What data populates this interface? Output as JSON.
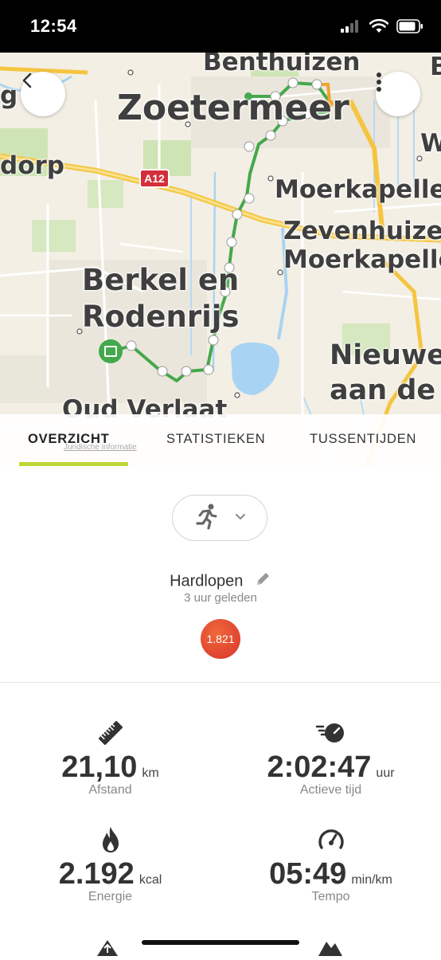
{
  "status_bar": {
    "time": "12:54"
  },
  "map": {
    "labels": {
      "benthuizen": "Benthuizen",
      "zoetermeer": "Zoetermeer",
      "dorp": "dorp",
      "a12": "A12",
      "moerkapelle1": "Moerkapelle",
      "zevenhuizen": "Zevenhuizen",
      "moerkapelle2": "Moerkapelle",
      "berkel1": "Berkel en",
      "berkel2": "Rodenrijs",
      "nieuw1": "Nieuwe",
      "nieuw2": "aan de",
      "oud_verlaat": "Oud Verlaat",
      "g": "g",
      "w": "W",
      "b": "B"
    },
    "legal": "Juridische informatie"
  },
  "tabs": [
    {
      "label": "OVERZICHT",
      "active": true
    },
    {
      "label": "STATISTIEKEN",
      "active": false
    },
    {
      "label": "TUSSENTIJDEN",
      "active": false
    }
  ],
  "activity": {
    "sport_icon": "running-icon",
    "title": "Hardlopen",
    "subtitle": "3 uur geleden",
    "score": "1.821",
    "score_color": "#e0402f"
  },
  "metrics": {
    "distance": {
      "value": "21,10",
      "unit": "km",
      "label": "Afstand",
      "icon": "ruler-icon"
    },
    "active_time": {
      "value": "2:02:47",
      "unit": "uur",
      "label": "Actieve tijd",
      "icon": "stopwatch-icon"
    },
    "energy": {
      "value": "2.192",
      "unit": "kcal",
      "label": "Energie",
      "icon": "flame-icon"
    },
    "pace": {
      "value": "05:49",
      "unit": "min/km",
      "label": "Tempo",
      "icon": "speedometer-icon"
    }
  },
  "colors": {
    "accent": "#c0d637",
    "route": "#4caf50"
  }
}
